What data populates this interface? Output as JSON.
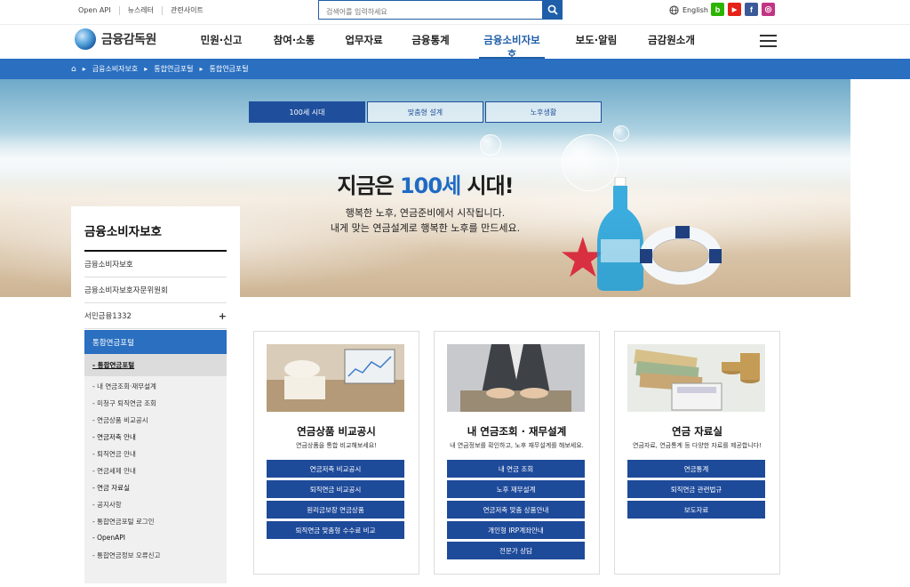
{
  "util": {
    "links": [
      "Open API",
      "뉴스레터",
      "관련사이트"
    ],
    "search_placeholder": "검색어를 입력하세요",
    "lang": "English",
    "sns": [
      "b",
      "▶",
      "f",
      "◎"
    ]
  },
  "logo": "금융감독원",
  "menu": [
    "민원·신고",
    "참여·소통",
    "업무자료",
    "금융통계",
    "금융소비자보호",
    "보도·알림",
    "금감원소개"
  ],
  "breadcrumb": [
    "금융소비자보호",
    "통합연금포털",
    "통합연금포털"
  ],
  "hero": {
    "tabs": [
      "100세 시대",
      "맞춤형 설계",
      "노후생활"
    ],
    "title_pre": "지금은 ",
    "title_hl": "100세",
    "title_post": " 시대!",
    "line1": "행복한 노후, 연금준비에서 시작됩니다.",
    "line2": "내게 맞는 연금설계로 행복한 노후를 만드세요."
  },
  "side": {
    "title": "금융소비자보호",
    "items": [
      "금융소비자보호",
      "금융소비자보호자문위원회",
      "서민금융1332"
    ],
    "plus": "+",
    "active": "통합연금포털",
    "current": "- 통합연금포털",
    "sub": [
      "내 연금조회·재무설계",
      "미청구 퇴직연금 조회",
      "연금상품 비교공시",
      "연금저축 안내",
      "퇴직연금 안내",
      "연금세제 안내",
      "연금 자료실",
      "공지사항",
      "통합연금포털 로그인",
      "OpenAPI",
      "통합연금정보 오류신고"
    ]
  },
  "cards": [
    {
      "title": "연금상품 비교공시",
      "desc": "연금상품을 통합 비교해보세요!",
      "buttons": [
        "연금저축 비교공시",
        "퇴직연금 비교공시",
        "원리금보장 연금상품",
        "퇴직연금 맞춤형 수수료 비교"
      ]
    },
    {
      "title": "내 연금조회 · 재무설계",
      "desc": "내 연금정보를 확인하고, 노후 재무설계를 해보세요.",
      "buttons": [
        "내 연금 조회",
        "노후 재무설계",
        "연금저축 맞춤 상품안내",
        "개인형 IRP계좌안내",
        "전문가 상담"
      ]
    },
    {
      "title": "연금 자료실",
      "desc": "연금자료, 연금통계 등 다양한 자료를 제공합니다!",
      "buttons": [
        "연금통계",
        "퇴직연금 관련법규",
        "보도자료"
      ]
    }
  ],
  "colors": {
    "primary": "#2a6fc0",
    "navy": "#1e4a9a",
    "youtube": "#e62117",
    "facebook": "#3b5998",
    "instagram": "#c13584",
    "blog": "#2db400"
  }
}
